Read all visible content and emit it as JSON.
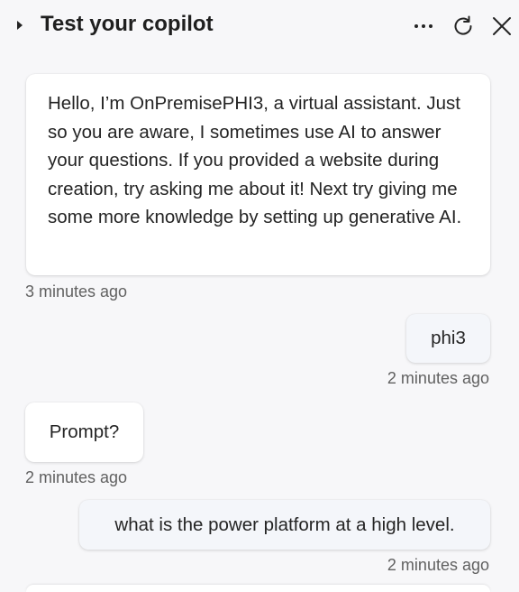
{
  "header": {
    "title": "Test your copilot",
    "toggle_icon": "caret-right-icon",
    "more_icon": "more-horizontal-icon",
    "refresh_icon": "refresh-icon",
    "close_icon": "close-icon"
  },
  "conversation": {
    "messages": [
      {
        "role": "bot",
        "text": "Hello, I’m OnPremisePHI3, a virtual assistant. Just so you are aware, I sometimes use AI to answer your questions. If you provided a website during creation, try asking me about it! Next try giving me some more knowledge by setting up generative AI.",
        "timestamp": "3 minutes ago"
      },
      {
        "role": "user",
        "text": "phi3",
        "timestamp": "2 minutes ago"
      },
      {
        "role": "bot",
        "text": "Prompt?",
        "timestamp": "2 minutes ago"
      },
      {
        "role": "user",
        "text": "what is the power platform at a high level.",
        "timestamp": "2 minutes ago"
      }
    ]
  },
  "colors": {
    "background": "#f7f7f9",
    "bubble": "#ffffff",
    "user_bubble": "#f4f6fa",
    "timestamp": "#616161",
    "title": "#1f1f1f"
  }
}
